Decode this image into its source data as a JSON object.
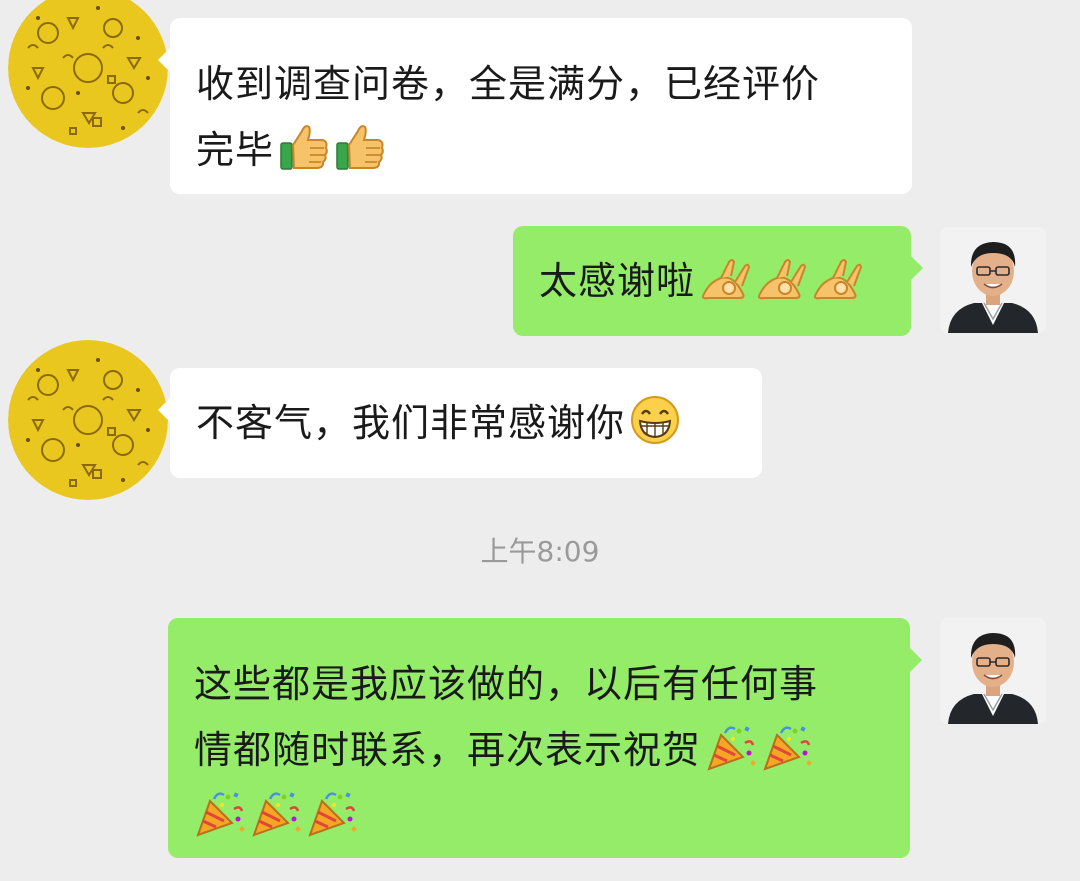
{
  "chat": {
    "messages": [
      {
        "sender": "contact",
        "lines": [
          "收到调查问卷，全是满分，已经评价",
          "完毕"
        ],
        "emojis": [
          "thumbs-up-icon",
          "thumbs-up-icon"
        ]
      },
      {
        "sender": "self",
        "text": "太感谢啦",
        "emojis": [
          "ok-hand-icon",
          "ok-hand-icon",
          "ok-hand-icon"
        ]
      },
      {
        "sender": "contact",
        "text": "不客气，我们非常感谢你",
        "emojis": [
          "grinning-face-icon"
        ]
      },
      {
        "sender": "self",
        "lines": [
          "这些都是我应该做的，以后有任何事",
          "情都随时联系，再次表示祝贺"
        ],
        "emojis": [
          "party-popper-icon",
          "party-popper-icon",
          "party-popper-icon",
          "party-popper-icon",
          "party-popper-icon"
        ]
      }
    ],
    "timestamp": "上午8:09"
  },
  "colors": {
    "background": "#EDEDED",
    "incoming_bubble": "#FFFFFF",
    "outgoing_bubble": "#95EC69",
    "timestamp_text": "#9A9A9A"
  }
}
